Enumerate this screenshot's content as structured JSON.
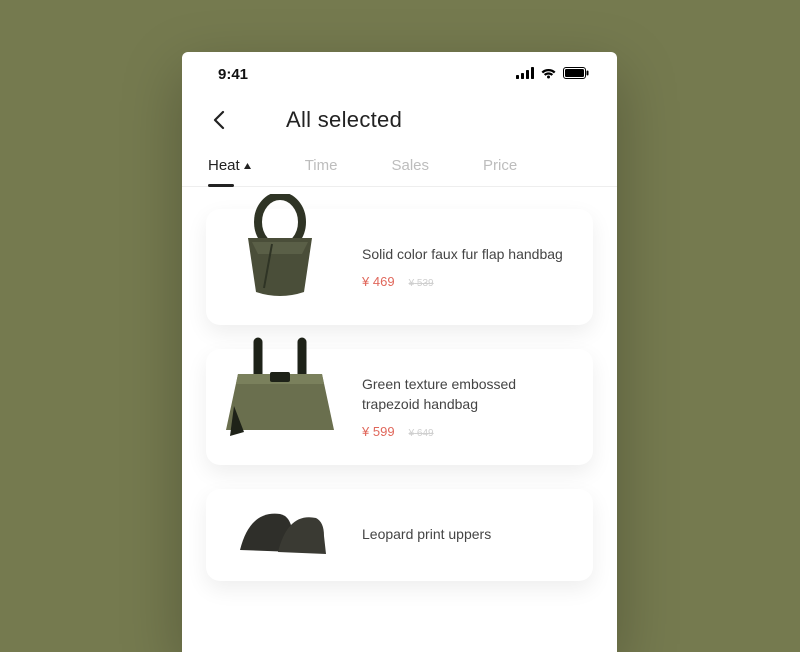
{
  "status": {
    "time": "9:41"
  },
  "header": {
    "title": "All selected"
  },
  "tabs": [
    {
      "label": "Heat",
      "active": true,
      "arrow": true
    },
    {
      "label": "Time",
      "active": false
    },
    {
      "label": "Sales",
      "active": false
    },
    {
      "label": "Price",
      "active": false
    }
  ],
  "currency": "¥",
  "products": [
    {
      "name": "Solid color faux fur flap handbag",
      "price": "469",
      "price_old": "539"
    },
    {
      "name": "Green texture embossed trapezoid handbag",
      "price": "599",
      "price_old": "649"
    },
    {
      "name": "Leopard print uppers",
      "price": "",
      "price_old": ""
    }
  ]
}
